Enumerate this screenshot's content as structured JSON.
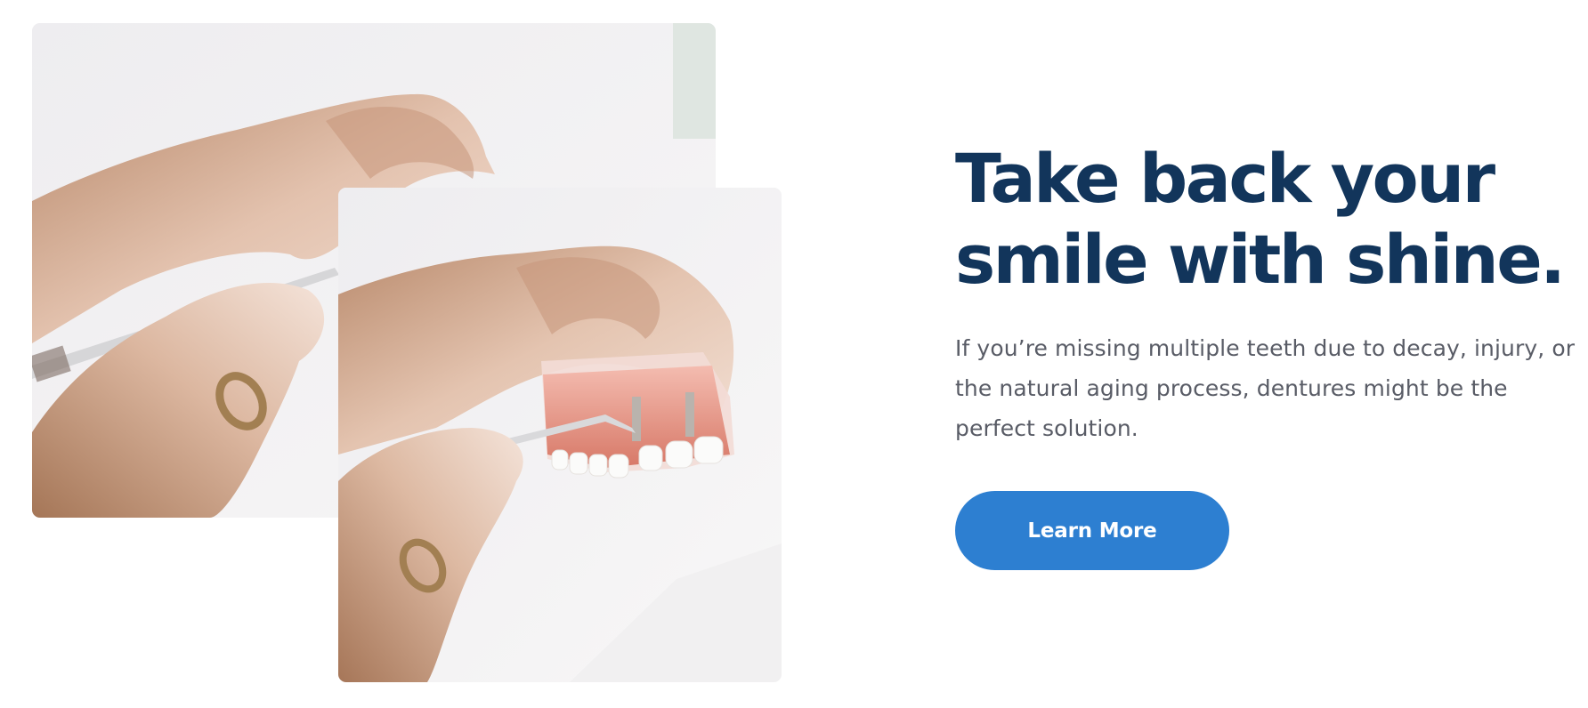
{
  "hero": {
    "headline_line1": "Take back your",
    "headline_line2": "smile with shine.",
    "intro": "If you’re missing multiple teeth due to decay, injury, or the natural aging process, dentures might be the perfect solution.",
    "cta_label": "Learn More"
  },
  "images": [
    {
      "name": "dental-model-photo",
      "depicts": "hands holding a dental implant model with a dental probe"
    },
    {
      "name": "dental-model-photo-closeup",
      "depicts": "hands holding a denture model with a dental probe"
    }
  ],
  "colors": {
    "heading": "#12355b",
    "body_text": "#595c66",
    "button": "#2d7fd1",
    "button_text": "#ffffff",
    "background": "#ffffff"
  }
}
